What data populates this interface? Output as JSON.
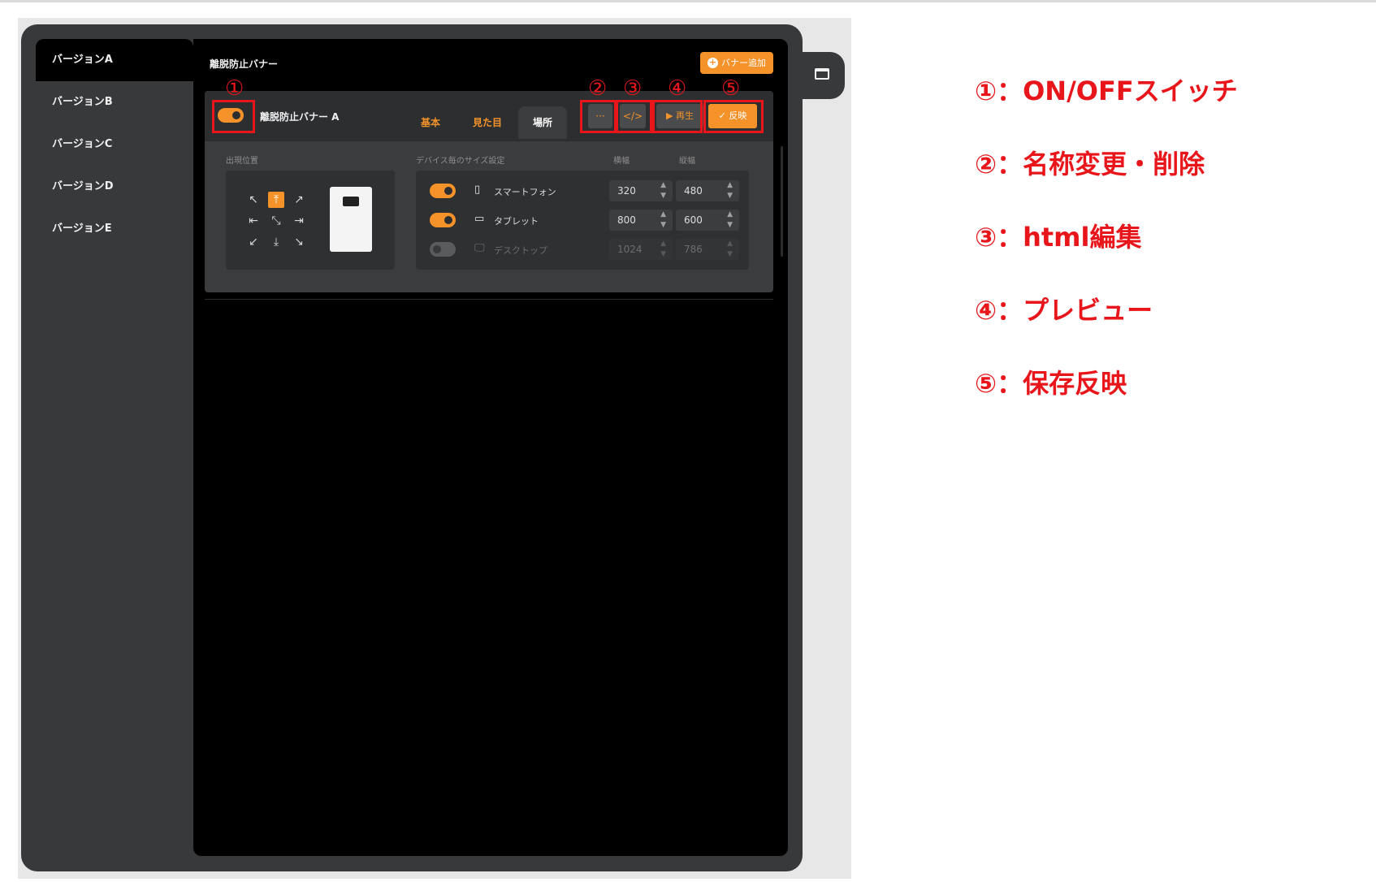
{
  "sidebar": {
    "items": [
      {
        "label": "バージョンA"
      },
      {
        "label": "バージョンB"
      },
      {
        "label": "バージョンC"
      },
      {
        "label": "バージョンD"
      },
      {
        "label": "バージョンE"
      }
    ]
  },
  "header": {
    "title": "離脱防止バナー",
    "add_button": "バナー追加",
    "add_icon": "+"
  },
  "card": {
    "banner_name": "離脱防止バナー A",
    "toggle_on": true,
    "tabs": [
      {
        "label": "基本"
      },
      {
        "label": "見た目"
      },
      {
        "label": "場所"
      }
    ],
    "buttons": {
      "more": "···",
      "html": "</>",
      "play": "▶ 再生",
      "save": "✓ 反映"
    }
  },
  "position": {
    "label": "出現位置",
    "arrows": [
      "↖",
      "⤒",
      "↗",
      "⇤",
      "⤡",
      "⇥",
      "↙",
      "⤓",
      "↘"
    ],
    "selected": "⤒"
  },
  "devices": {
    "label": "デバイス毎のサイズ設定",
    "width_label": "横幅",
    "height_label": "縦幅",
    "rows": [
      {
        "icon": "▯",
        "name": "スマートフォン",
        "enabled": true,
        "width": "320",
        "height": "480"
      },
      {
        "icon": "▭",
        "name": "タブレット",
        "enabled": true,
        "width": "800",
        "height": "600"
      },
      {
        "icon": "🖵",
        "name": "デスクトップ",
        "enabled": false,
        "width": "1024",
        "height": "786"
      }
    ]
  },
  "callouts": [
    "①",
    "②",
    "③",
    "④",
    "⑤"
  ],
  "legend": [
    "①：ON/OFFスイッチ",
    "②：名称変更・削除",
    "③：html編集",
    "④：プレビュー",
    "⑤：保存反映"
  ],
  "colors": {
    "accent": "#f5922a",
    "annotation": "#e8161b",
    "panel": "#38393b",
    "background": "#000000"
  }
}
